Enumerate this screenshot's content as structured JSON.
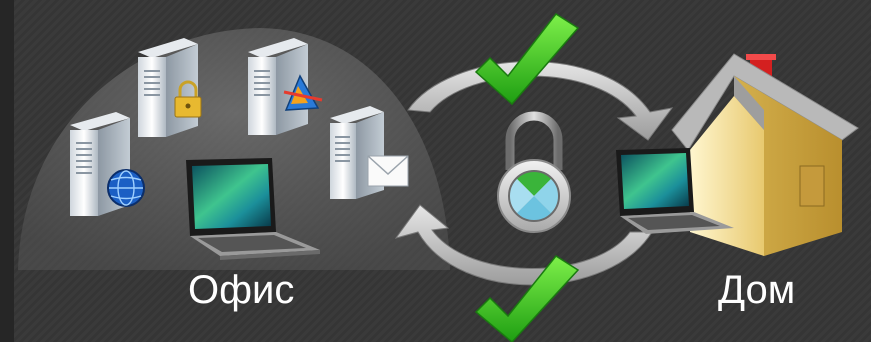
{
  "labels": {
    "office": "Офис",
    "home": "Дом"
  },
  "colors": {
    "background": "#363636",
    "dome": "#6a6a6a",
    "check": "#3cc21a",
    "arrow": "#c9c9c9",
    "roof": "#b0b0b0",
    "house_wall": "#f3e2a3",
    "chimney": "#d42020"
  },
  "icons": [
    "server-globe-icon",
    "server-lock-icon",
    "server-app-icon",
    "server-mail-icon",
    "laptop-icon",
    "padlock-icon",
    "house-icon",
    "checkmark-icon"
  ]
}
